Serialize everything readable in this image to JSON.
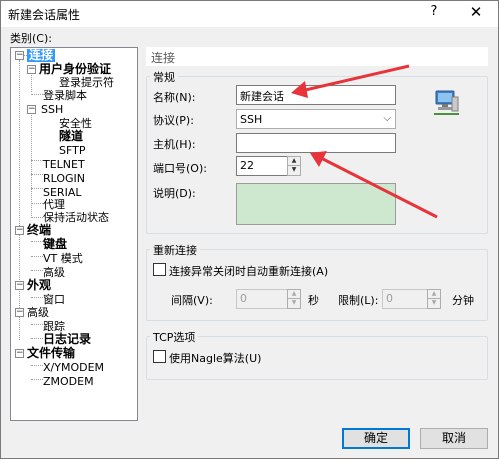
{
  "window": {
    "title": "新建会话属性",
    "help": "?",
    "close": "✕"
  },
  "category_label": "类别(C):",
  "tree": {
    "connection": "连接",
    "auth": "用户身份验证",
    "login_prompt": "登录提示符",
    "login_script": "登录脚本",
    "ssh": "SSH",
    "security": "安全性",
    "tunnel": "隧道",
    "sftp": "SFTP",
    "telnet": "TELNET",
    "rlogin": "RLOGIN",
    "serial": "SERIAL",
    "proxy": "代理",
    "keepalive": "保持活动状态",
    "terminal": "终端",
    "keyboard": "键盘",
    "vt_mode": "VT 模式",
    "terminal_advanced": "高级",
    "appearance": "外观",
    "appearance_window": "窗口",
    "advanced": "高级",
    "trace": "跟踪",
    "logging": "日志记录",
    "file_transfer": "文件传输",
    "xymodem": "X/YMODEM",
    "zmodem": "ZMODEM"
  },
  "panel_title": "连接",
  "general": {
    "group_title": "常规",
    "name_label": "名称(N):",
    "name_value": "新建会话",
    "protocol_label": "协议(P):",
    "protocol_value": "SSH",
    "host_label": "主机(H):",
    "host_value": "",
    "port_label": "端口号(O):",
    "port_value": "22",
    "desc_label": "说明(D):",
    "desc_value": ""
  },
  "reconnect": {
    "group_title": "重新连接",
    "checkbox_label": "连接异常关闭时自动重新连接(A)",
    "interval_label": "间隔(V):",
    "interval_value": "0",
    "interval_unit": "秒",
    "limit_label": "限制(L):",
    "limit_value": "0",
    "limit_unit": "分钟"
  },
  "tcp": {
    "group_title": "TCP选项",
    "nagle_label": "使用Nagle算法(U)"
  },
  "buttons": {
    "ok": "确定",
    "cancel": "取消"
  },
  "colors": {
    "selection": "#3399ff",
    "description_bg": "#cde8cf",
    "annotation_arrow": "#e8333a"
  }
}
